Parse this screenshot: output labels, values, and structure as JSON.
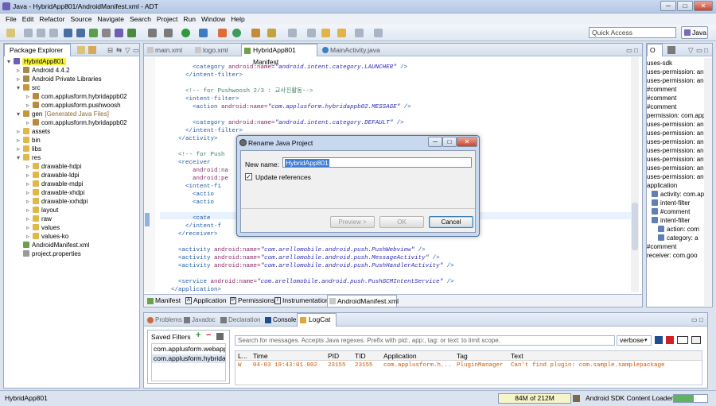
{
  "window": {
    "title": "Java - HybridApp801/AndroidManifest.xml - ADT",
    "btn_min": "─",
    "btn_max": "□",
    "btn_close": "✕"
  },
  "menu": [
    "File",
    "Edit",
    "Refactor",
    "Source",
    "Navigate",
    "Search",
    "Project",
    "Run",
    "Window",
    "Help"
  ],
  "toolbar": {
    "quick_access": "Quick Access",
    "perspective": "Java"
  },
  "explorer": {
    "title": "Package Explorer",
    "tab2_title": "Hierarchy",
    "items": [
      {
        "label": "HybridApp801",
        "indent": 0,
        "fold": "▾",
        "icon": "project"
      },
      {
        "label": "Android 4.4.2",
        "indent": 1,
        "fold": "▹",
        "icon": "lib"
      },
      {
        "label": "Android Private Libraries",
        "indent": 1,
        "fold": "▹",
        "icon": "lib"
      },
      {
        "label": "src",
        "indent": 1,
        "fold": "▾",
        "icon": "src"
      },
      {
        "label": "com.applusform.hybridappb02",
        "indent": 2,
        "fold": "▹",
        "icon": "pkg"
      },
      {
        "label": "com.applusform.pushwoosh",
        "indent": 2,
        "fold": "▹",
        "icon": "pkg"
      },
      {
        "label": "gen",
        "indent": 1,
        "fold": "▾",
        "icon": "src",
        "suffix": "[Generated Java Files]"
      },
      {
        "label": "com.applusform.hybridappb02",
        "indent": 2,
        "fold": "▹",
        "icon": "pkg"
      },
      {
        "label": "assets",
        "indent": 1,
        "fold": "▹",
        "icon": "folder"
      },
      {
        "label": "bin",
        "indent": 1,
        "fold": "▹",
        "icon": "folder"
      },
      {
        "label": "libs",
        "indent": 1,
        "fold": "▹",
        "icon": "folder"
      },
      {
        "label": "res",
        "indent": 1,
        "fold": "▾",
        "icon": "folder"
      },
      {
        "label": "drawable-hdpi",
        "indent": 2,
        "fold": "▹",
        "icon": "folder"
      },
      {
        "label": "drawable-ldpi",
        "indent": 2,
        "fold": "▹",
        "icon": "folder"
      },
      {
        "label": "drawable-mdpi",
        "indent": 2,
        "fold": "▹",
        "icon": "folder"
      },
      {
        "label": "drawable-xhdpi",
        "indent": 2,
        "fold": "▹",
        "icon": "folder"
      },
      {
        "label": "drawable-xxhdpi",
        "indent": 2,
        "fold": "▹",
        "icon": "folder"
      },
      {
        "label": "layout",
        "indent": 2,
        "fold": "▹",
        "icon": "folder"
      },
      {
        "label": "raw",
        "indent": 2,
        "fold": "▹",
        "icon": "folder"
      },
      {
        "label": "values",
        "indent": 2,
        "fold": "▹",
        "icon": "folder"
      },
      {
        "label": "values-ko",
        "indent": 2,
        "fold": "▹",
        "icon": "folder"
      },
      {
        "label": "AndroidManifest.xml",
        "indent": 1,
        "fold": "",
        "icon": "xml"
      },
      {
        "label": "project.properties",
        "indent": 1,
        "fold": "",
        "icon": "file"
      }
    ]
  },
  "editor": {
    "tabs": [
      "main.xml",
      "logo.xml",
      "HybridApp801 Manifest",
      "MainActivity.java"
    ],
    "bottom_tabs": [
      "Manifest",
      "Application",
      "Permissions",
      "Instrumentation",
      "AndroidManifest.xml"
    ]
  },
  "outline": {
    "title": "O",
    "items": [
      "uses-sdk",
      "uses-permission: and",
      "uses-permission: and",
      "#comment",
      "#comment",
      "#comment",
      "permission: com.app",
      "uses-permission: and",
      "uses-permission: and",
      "uses-permission: and",
      "uses-permission: and",
      "uses-permission: and",
      "uses-permission: and",
      "uses-permission: and",
      "application",
      "activity: com.app",
      "intent-filter",
      "#comment",
      "intent-filter",
      "action: com",
      "category: a",
      "#comment",
      "receiver: com.goo"
    ]
  },
  "dialog": {
    "title": "Rename Java Project",
    "name_label": "New name:",
    "name_value": "HybridApp801",
    "checkbox_label": "Update references",
    "preview": "Preview >",
    "ok": "OK",
    "cancel": "Cancel"
  },
  "console": {
    "tabs": [
      "Problems",
      "Javadoc",
      "Declaration",
      "Console",
      "LogCat"
    ],
    "saved_filters": "Saved Filters",
    "filters": [
      "com.applusform.webapp",
      "com.applusform.hybrida"
    ],
    "search_placeholder": "Search for messages. Accepts Java regexes. Prefix with pid:, app:, tag: or text: to limit scope.",
    "level": "verbose",
    "columns": [
      "L...",
      "Time",
      "PID",
      "TID",
      "Application",
      "Tag",
      "Text"
    ],
    "rows": [
      {
        "level": "W",
        "time": "04-03 19:43:01.002",
        "pid": "23155",
        "tid": "23155",
        "app": "com.applusform.h...",
        "tag": "PluginManager",
        "text": "Can't find plugin: com.sample.samplepackage"
      }
    ]
  },
  "status": {
    "left": "HybridApp801",
    "memory": "84M of 212M",
    "job": "Android SDK Content Loader"
  }
}
